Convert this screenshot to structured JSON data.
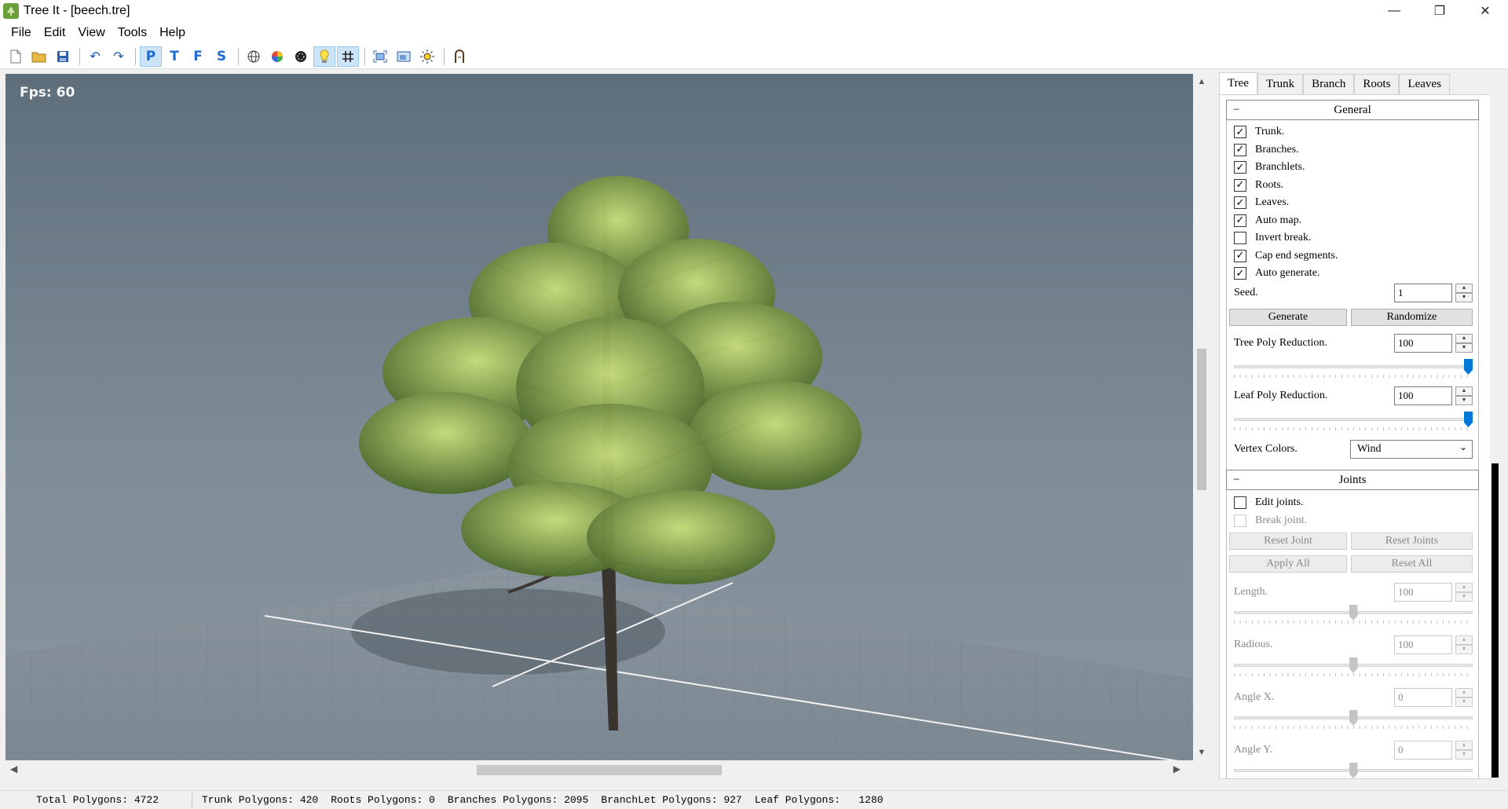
{
  "window": {
    "title": "Tree It - [beech.tre]",
    "controls": {
      "minimize": "—",
      "maximize": "❐",
      "close": "✕"
    }
  },
  "menu": [
    "File",
    "Edit",
    "View",
    "Tools",
    "Help"
  ],
  "toolbar": {
    "letters": {
      "p": "P",
      "t": "T",
      "f": "F",
      "s": "S"
    },
    "icons": [
      "new-file-icon",
      "open-folder-icon",
      "save-icon",
      "undo-icon",
      "redo-icon",
      "perspective-view-icon",
      "top-view-icon",
      "front-view-icon",
      "side-view-icon",
      "wireframe-icon",
      "color-wheel-icon",
      "texture-icon",
      "light-icon",
      "grid-icon",
      "fit-view-icon",
      "screenshot-icon",
      "sun-icon",
      "wind-icon"
    ]
  },
  "viewport": {
    "fps": "Fps: 60"
  },
  "statusbar": {
    "total": "Total Polygons: 4722",
    "trunk": "Trunk Polygons: 420",
    "roots": "Roots Polygons: 0",
    "branches": "Branches Polygons: 2095",
    "branchlet": "BranchLet Polygons: 927",
    "leaf": "Leaf Polygons:   1280"
  },
  "panel": {
    "tabs": [
      "Tree",
      "Trunk",
      "Branch",
      "Roots",
      "Leaves"
    ],
    "active_tab": "Tree",
    "general": {
      "title": "General",
      "collapse": "−",
      "checkboxes": [
        {
          "label": "Trunk.",
          "checked": true
        },
        {
          "label": "Branches.",
          "checked": true
        },
        {
          "label": "Branchlets.",
          "checked": true
        },
        {
          "label": "Roots.",
          "checked": true
        },
        {
          "label": "Leaves.",
          "checked": true
        },
        {
          "label": "Auto map.",
          "checked": true
        },
        {
          "label": "Invert break.",
          "checked": false
        },
        {
          "label": "Cap end segments.",
          "checked": true
        },
        {
          "label": "Auto generate.",
          "checked": true
        }
      ],
      "seed_label": "Seed.",
      "seed_value": "1",
      "generate": "Generate",
      "randomize": "Randomize",
      "tree_poly_label": "Tree Poly Reduction.",
      "tree_poly_value": "100",
      "tree_poly_level": 1.0,
      "leaf_poly_label": "Leaf Poly Reduction.",
      "leaf_poly_value": "100",
      "leaf_poly_level": 1.0,
      "vertex_colors_label": "Vertex Colors.",
      "vertex_colors_value": "Wind"
    },
    "joints": {
      "title": "Joints",
      "collapse": "−",
      "edit_joints": "Edit joints.",
      "break_joint": "Break joint.",
      "reset_joint": "Reset Joint",
      "reset_joints": "Reset Joints",
      "apply_all": "Apply All",
      "reset_all": "Reset All",
      "length_label": "Length.",
      "length_value": "100",
      "radious_label": "Radious.",
      "radious_value": "100",
      "anglex_label": "Angle X.",
      "anglex_value": "0",
      "angley_label": "Angle Y.",
      "angley_value": "0",
      "slider_level": 0.5
    }
  }
}
